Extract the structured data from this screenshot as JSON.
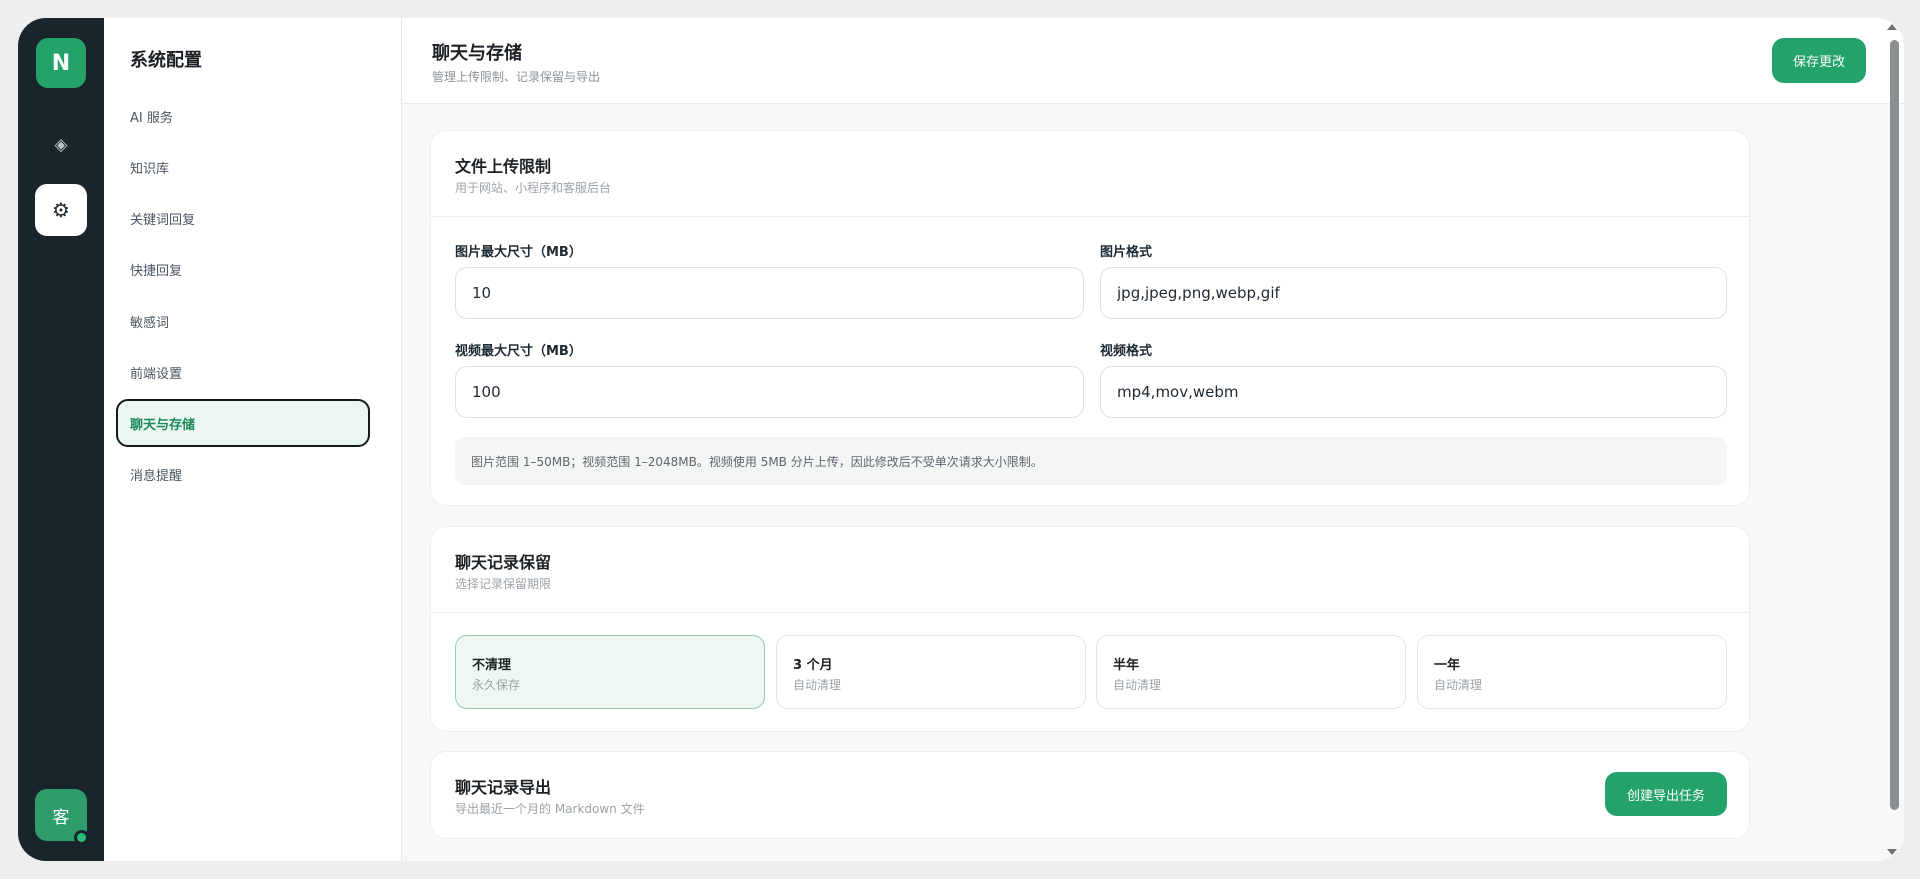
{
  "rail": {
    "logo": "N",
    "avatar": "客"
  },
  "sidenav": {
    "title": "系统配置",
    "items": [
      {
        "label": "AI 服务"
      },
      {
        "label": "知识库"
      },
      {
        "label": "关键词回复"
      },
      {
        "label": "快捷回复"
      },
      {
        "label": "敏感词"
      },
      {
        "label": "前端设置"
      },
      {
        "label": "聊天与存储",
        "active": true
      },
      {
        "label": "消息提醒"
      }
    ]
  },
  "header": {
    "title": "聊天与存储",
    "subtitle": "管理上传限制、记录保留与导出",
    "save_label": "保存更改"
  },
  "upload": {
    "title": "文件上传限制",
    "subtitle": "用于网站、小程序和客服后台",
    "image_max_label": "图片最大尺寸（MB）",
    "image_max_value": "10",
    "image_format_label": "图片格式",
    "image_format_value": "jpg,jpeg,png,webp,gif",
    "video_max_label": "视频最大尺寸（MB）",
    "video_max_value": "100",
    "video_format_label": "视频格式",
    "video_format_value": "mp4,mov,webm",
    "note": "图片范围 1–50MB；视频范围 1–2048MB。视频使用 5MB 分片上传，因此修改后不受单次请求大小限制。"
  },
  "retention": {
    "title": "聊天记录保留",
    "subtitle": "选择记录保留期限",
    "options": [
      {
        "title": "不清理",
        "sub": "永久保存",
        "selected": true
      },
      {
        "title": "3 个月",
        "sub": "自动清理"
      },
      {
        "title": "半年",
        "sub": "自动清理"
      },
      {
        "title": "一年",
        "sub": "自动清理"
      }
    ]
  },
  "export": {
    "title": "聊天记录导出",
    "subtitle": "导出最近一个月的 Markdown 文件",
    "button": "创建导出任务"
  },
  "colors": {
    "accent": "#23a26a",
    "rail": "#19242b",
    "selected_bg": "#eef7f1"
  }
}
